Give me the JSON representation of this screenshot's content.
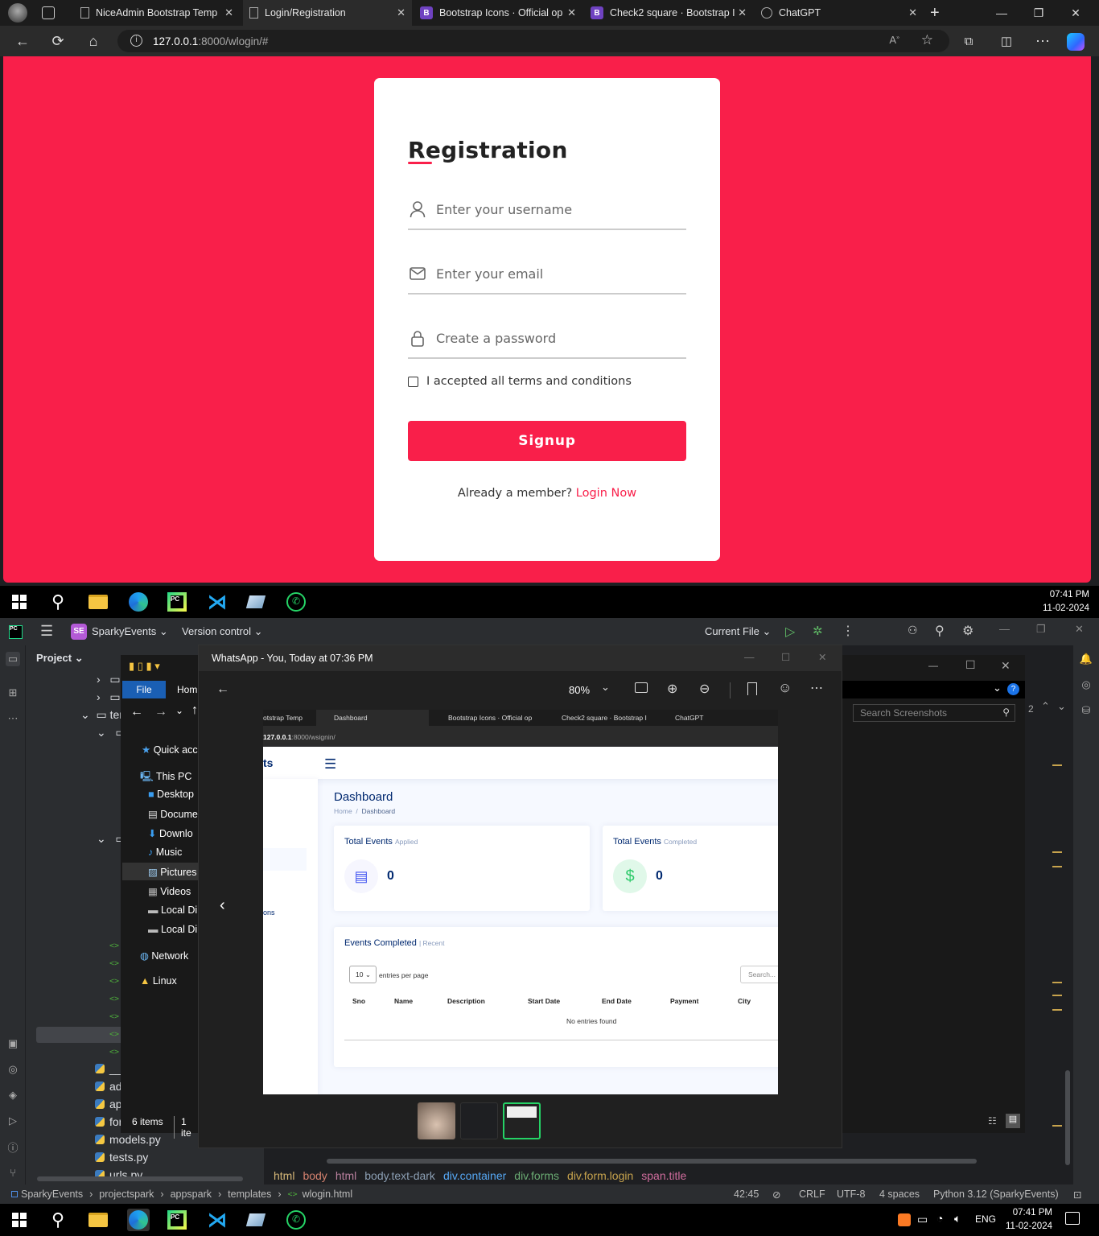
{
  "browser": {
    "tabs": [
      {
        "label": "NiceAdmin Bootstrap Temp",
        "icon": "page-icon",
        "active": false
      },
      {
        "label": "Login/Registration",
        "icon": "page-icon",
        "active": true
      },
      {
        "label": "Bootstrap Icons · Official op",
        "icon": "bootstrap-icon",
        "active": false
      },
      {
        "label": "Check2 square · Bootstrap I",
        "icon": "bootstrap-icon",
        "active": false
      },
      {
        "label": "ChatGPT",
        "icon": "chatgpt-icon",
        "active": false
      }
    ],
    "url_host": "127.0.0.1",
    "url_rest": ":8000/wlogin/#"
  },
  "registration": {
    "title": "Registration",
    "username_placeholder": "Enter your username",
    "email_placeholder": "Enter your email",
    "password_placeholder": "Create a password",
    "terms_label": "I accepted all terms and conditions",
    "signup_label": "Signup",
    "member_text": "Already a member?",
    "login_link": "Login Now",
    "accent_color": "#f91f4a"
  },
  "taskbar_top": {
    "time": "07:41 PM",
    "date": "11-02-2024"
  },
  "taskbar_bottom": {
    "time": "07:41 PM",
    "date": "11-02-2024",
    "lang": "ENG"
  },
  "ide": {
    "project_badge": "SE",
    "project_name": "SparkyEvents",
    "vcs": "Version control",
    "run_config": "Current File",
    "panel_title": "Project",
    "tree": [
      "ter",
      "__i",
      "ad",
      "ap",
      "for",
      "models.py",
      "tests.py",
      "urls.py"
    ],
    "breadcrumb": [
      "html",
      "body",
      "html",
      "body.text-dark",
      "div.container",
      "div.forms",
      "div.form.login",
      "span.title"
    ],
    "status": {
      "path": [
        "SparkyEvents",
        "projectspark",
        "appspark",
        "templates",
        "wlogin.html"
      ],
      "position": "42:45",
      "line_sep": "CRLF",
      "encoding": "UTF-8",
      "indent": "4 spaces",
      "interpreter": "Python 3.12 (SparkyEvents)"
    },
    "right_count": "2"
  },
  "explorer": {
    "menu": [
      "File",
      "Hom"
    ],
    "nav": [
      "Quick acc",
      "This PC",
      "Desktop",
      "Docume",
      "Downlo",
      "Music",
      "Pictures",
      "Videos",
      "Local Di",
      "Local Di",
      "Network",
      "Linux"
    ],
    "status_items": "6 items",
    "status_sel": "1 ite",
    "search_placeholder": "Search Screenshots"
  },
  "whatsapp": {
    "title": "WhatsApp - You, Today at 07:36 PM",
    "zoom": "80%",
    "screenshot": {
      "tabs": [
        "otstrap Temp",
        "Dashboard",
        "Bootstrap Icons · Official op",
        "Check2 square · Bootstrap I",
        "ChatGPT"
      ],
      "url_host": "127.0.0.1",
      "url_rest": ":8000/wsignin/",
      "logo_frag": "ts",
      "side_frag": "ons",
      "heading": "Dashboard",
      "crumb_home": "Home",
      "crumb_sep": "/",
      "crumb_page": "Dashboard",
      "card1_title": "Total Events",
      "card1_sub": "Applied",
      "card1_value": "0",
      "card2_title": "Total Events",
      "card2_sub": "Completed",
      "card2_value": "0",
      "table_title": "Events Completed",
      "table_sub": "| Recent",
      "entries_value": "10",
      "entries_label": "entries per page",
      "search": "Search...",
      "columns": [
        "Sno",
        "Name",
        "Description",
        "Start Date",
        "End Date",
        "Payment",
        "City"
      ],
      "empty": "No entries found"
    }
  }
}
